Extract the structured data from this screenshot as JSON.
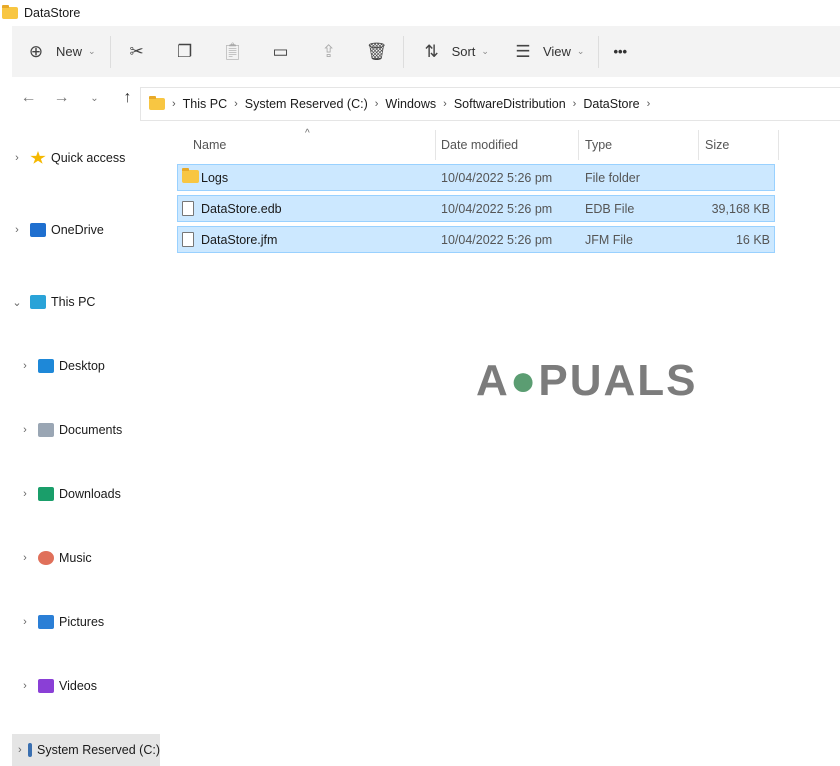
{
  "window": {
    "title": "DataStore"
  },
  "toolbar": {
    "new": "New",
    "sort": "Sort",
    "view": "View",
    "more": "•••"
  },
  "address": {
    "crumbs": [
      "This PC",
      "System Reserved (C:)",
      "Windows",
      "SoftwareDistribution",
      "DataStore"
    ]
  },
  "sidebar": {
    "items": [
      {
        "label": "Quick access",
        "icon": "star-icon",
        "color": "#f5b800"
      },
      {
        "label": "OneDrive",
        "icon": "onedrive-icon",
        "color": "#1f6fcf"
      },
      {
        "label": "This PC",
        "icon": "computer-icon",
        "color": "#2aa3d8"
      },
      {
        "label": "Desktop",
        "icon": "desktop-icon",
        "color": "#1e88d8"
      },
      {
        "label": "Documents",
        "icon": "documents-icon",
        "color": "#9aa6b4"
      },
      {
        "label": "Downloads",
        "icon": "download-icon",
        "color": "#1a9e6a"
      },
      {
        "label": "Music",
        "icon": "music-icon",
        "color": "#e0705a"
      },
      {
        "label": "Pictures",
        "icon": "pictures-icon",
        "color": "#2b7fd6"
      },
      {
        "label": "Videos",
        "icon": "videos-icon",
        "color": "#8a3fd6"
      },
      {
        "label": "System Reserved (C:)",
        "icon": "drive-icon",
        "color": "#3a6fb0"
      }
    ]
  },
  "columns": {
    "name": "Name",
    "date": "Date modified",
    "type": "Type",
    "size": "Size"
  },
  "files": [
    {
      "name": "Logs",
      "date": "10/04/2022 5:26 pm",
      "type": "File folder",
      "size": ""
    },
    {
      "name": "DataStore.edb",
      "date": "10/04/2022 5:26 pm",
      "type": "EDB File",
      "size": "39,168 KB"
    },
    {
      "name": "DataStore.jfm",
      "date": "10/04/2022 5:26 pm",
      "type": "JFM File",
      "size": "16 KB"
    }
  ],
  "watermark": "APPUALS"
}
